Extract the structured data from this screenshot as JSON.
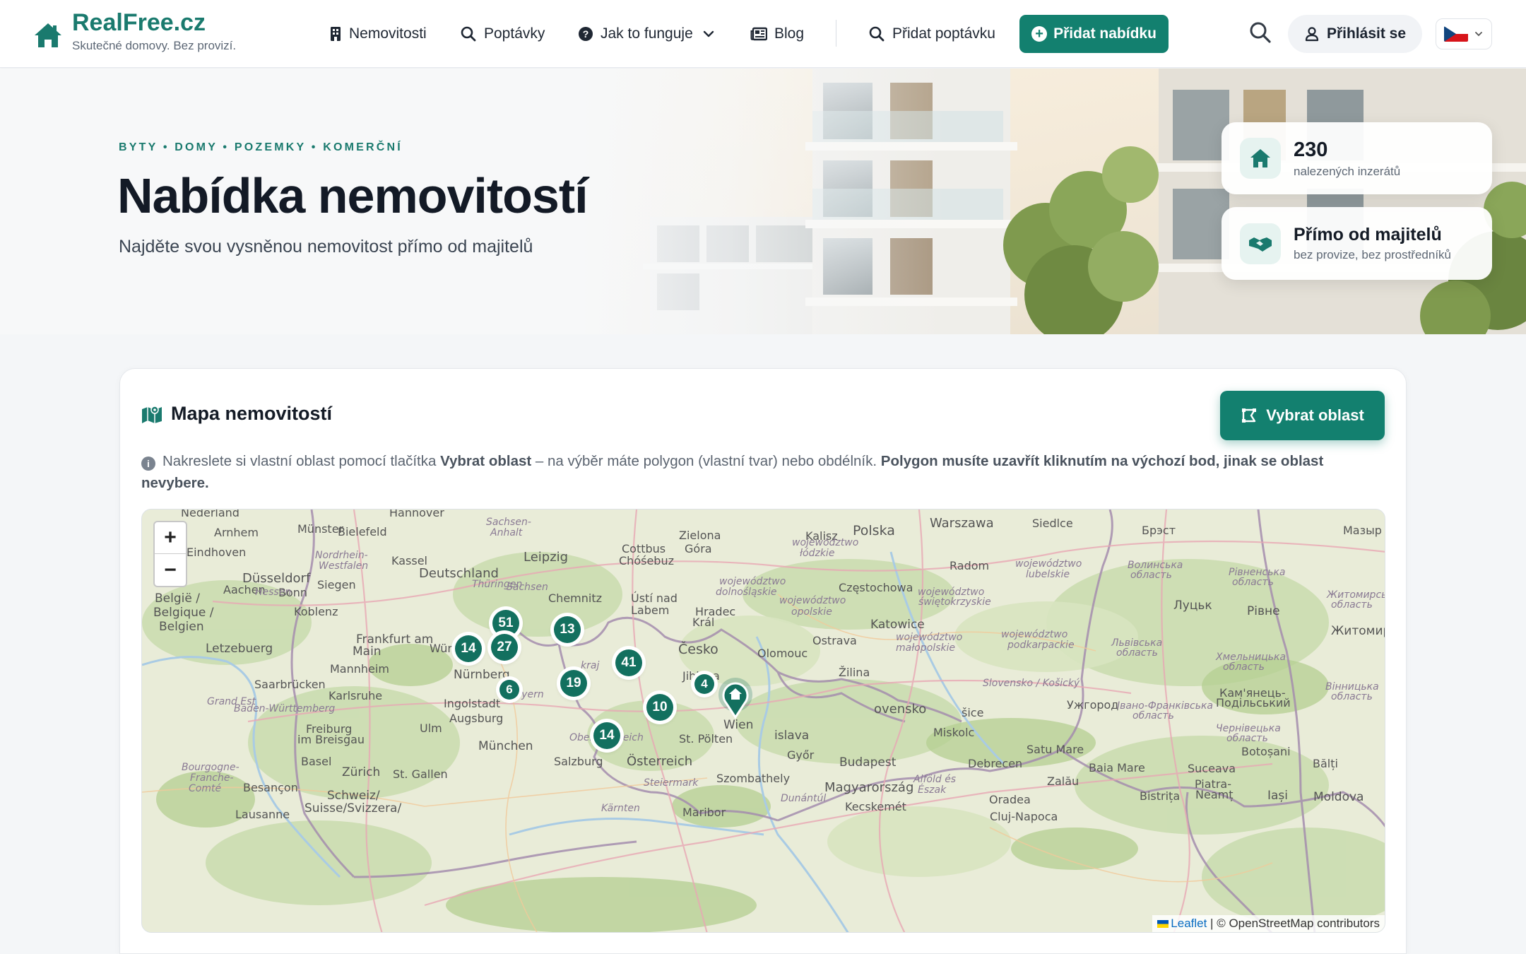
{
  "brand": {
    "name": "RealFree.cz",
    "tagline": "Skutečné domovy. Bez provizí.",
    "color": "#1a7a6e"
  },
  "nav": {
    "links": [
      {
        "label": "Nemovitosti",
        "icon": "building-icon"
      },
      {
        "label": "Poptávky",
        "icon": "search-icon"
      },
      {
        "label": "Jak to funguje",
        "icon": "question-circle-icon"
      },
      {
        "label": "Blog",
        "icon": "newspaper-icon"
      },
      {
        "label": "Přidat poptávku",
        "icon": "search-icon"
      }
    ],
    "add_offer": "Přidat nabídku",
    "login": "Přihlásit se",
    "language": "cs"
  },
  "hero": {
    "eyebrow": "BYTY • DOMY • POZEMKY • KOMERČNÍ",
    "title": "Nabídka nemovitostí",
    "subtitle": "Najděte svou vysněnou nemovitost přímo od majitelů",
    "stats": [
      {
        "value": "230",
        "label": "nalezených inzerátů",
        "icon": "home-icon"
      },
      {
        "value": "Přímo od majitelů",
        "label": "bez provize, bez prostředníků",
        "icon": "handshake-icon"
      }
    ]
  },
  "map_section": {
    "title": "Mapa nemovitostí",
    "select_area": "Vybrat oblast",
    "info_prefix": "Nakreslete si vlastní oblast pomocí tlačítka ",
    "info_button_ref": "Vybrat oblast",
    "info_middle": " – na výběr máte polygon (vlastní tvar) nebo obdélník. ",
    "info_bold": "Polygon musíte uzavřít kliknutím na výchozí bod, jinak se oblast nevybere.",
    "zoom_in": "+",
    "zoom_out": "−",
    "attribution_leaflet": "Leaflet",
    "attribution_rest": " | © OpenStreetMap contributors",
    "clusters": [
      "51",
      "13",
      "14",
      "27",
      "41",
      "6",
      "19",
      "4",
      "10",
      "14"
    ],
    "places": [
      "Nederland",
      "Hannover",
      "Polska",
      "Warszawa",
      "Siedlce",
      "Брэст",
      "Мазыр",
      "Münster",
      "Bielefeld",
      "Arnhem",
      "Eindhoven",
      "Zielona Góra",
      "Kalisz",
      "Cottbus Chóśebuz",
      "Leipzig",
      "Kassel",
      "Deutschland",
      "Radom",
      "Düsseldorf",
      "Siegen",
      "Aachen",
      "Bonn",
      "België / Belgique / Belgien",
      "Koblenz",
      "Chemnitz",
      "Ústí nad Labem",
      "Hradec Králové",
      "Częstochowa",
      "Katowice",
      "Луцьк",
      "Рівне",
      "Житомир",
      "Frankfurt am Main",
      "Würzburg",
      "Letzebuerg",
      "Česko",
      "Olomouc",
      "Ostrava",
      "Mannheim",
      "Nürnberg",
      "Jihlava",
      "Žilina",
      "Saarbrücken",
      "Karlsruhe",
      "Ingolstadt",
      "Augsburg",
      "Ужгород",
      "Кам'янець-Подільський",
      "Freiburg im Breisgau",
      "Ulm",
      "Wien",
      "Slovensko",
      "Košice",
      "Miskolc",
      "München",
      "St. Pölten",
      "Bratislava",
      "Győr",
      "Satu Mare",
      "Basel",
      "Zürich",
      "St. Gallen",
      "Salzburg",
      "Österreich",
      "Budapest",
      "Debrecen",
      "Baia Mare",
      "Botoșani",
      "Bălți",
      "Szombathely",
      "Magyarország",
      "Besançon",
      "Schweiz/Suisse/Svizzera/Svizra",
      "Lausanne",
      "Maribor",
      "Kecskemét",
      "Oradea",
      "Cluj-Napoca",
      "Zalău",
      "Bistrița",
      "Iași",
      "Moldova",
      "Piatra-Neamț",
      "Suceava"
    ]
  }
}
